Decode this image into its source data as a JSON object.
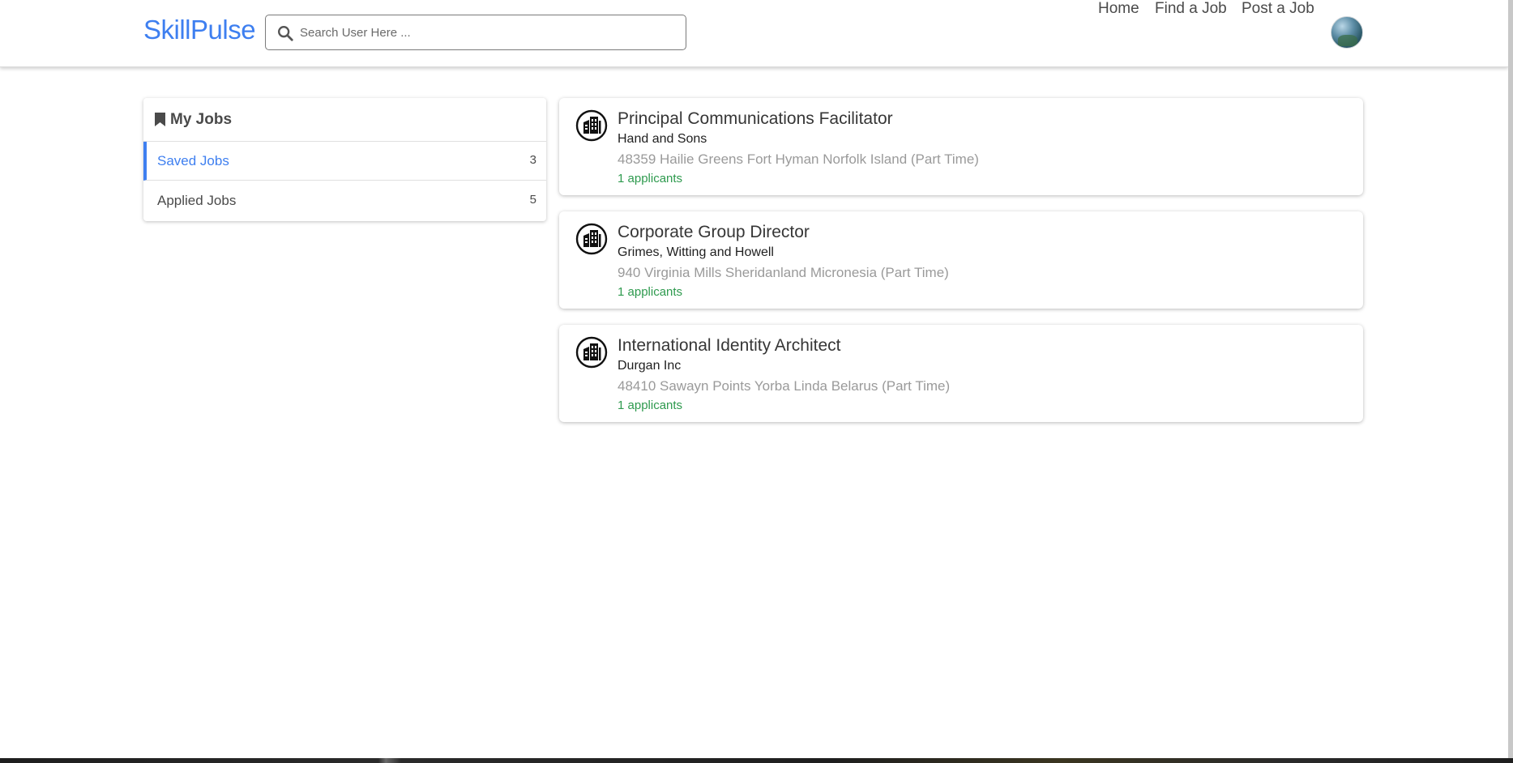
{
  "navbar": {
    "brand": "SkillPulse",
    "search_placeholder": "Search User Here ...",
    "links": [
      "Home",
      "Find a Job",
      "Post a Job"
    ]
  },
  "sidebar": {
    "title": "My Jobs",
    "items": [
      {
        "label": "Saved Jobs",
        "count": "3"
      },
      {
        "label": "Applied Jobs",
        "count": "5"
      }
    ]
  },
  "jobs": [
    {
      "title": "Principal Communications Facilitator",
      "company": "Hand and Sons",
      "location": "48359 Hailie Greens Fort Hyman Norfolk Island (Part Time)",
      "applicants": "1 applicants"
    },
    {
      "title": "Corporate Group Director",
      "company": "Grimes, Witting and Howell",
      "location": "940 Virginia Mills Sheridanland Micronesia (Part Time)",
      "applicants": "1 applicants"
    },
    {
      "title": "International Identity Architect",
      "company": "Durgan Inc",
      "location": "48410 Sawayn Points Yorba Linda Belarus (Part Time)",
      "applicants": "1 applicants"
    }
  ],
  "colors": {
    "accent": "#3e7ff0",
    "applicants": "#2e9a4e",
    "muted": "#9a9a9a"
  },
  "icons": {
    "search": "search-icon",
    "bookmark": "bookmark-icon",
    "company_logo": "building-icon",
    "avatar": "user-avatar"
  }
}
